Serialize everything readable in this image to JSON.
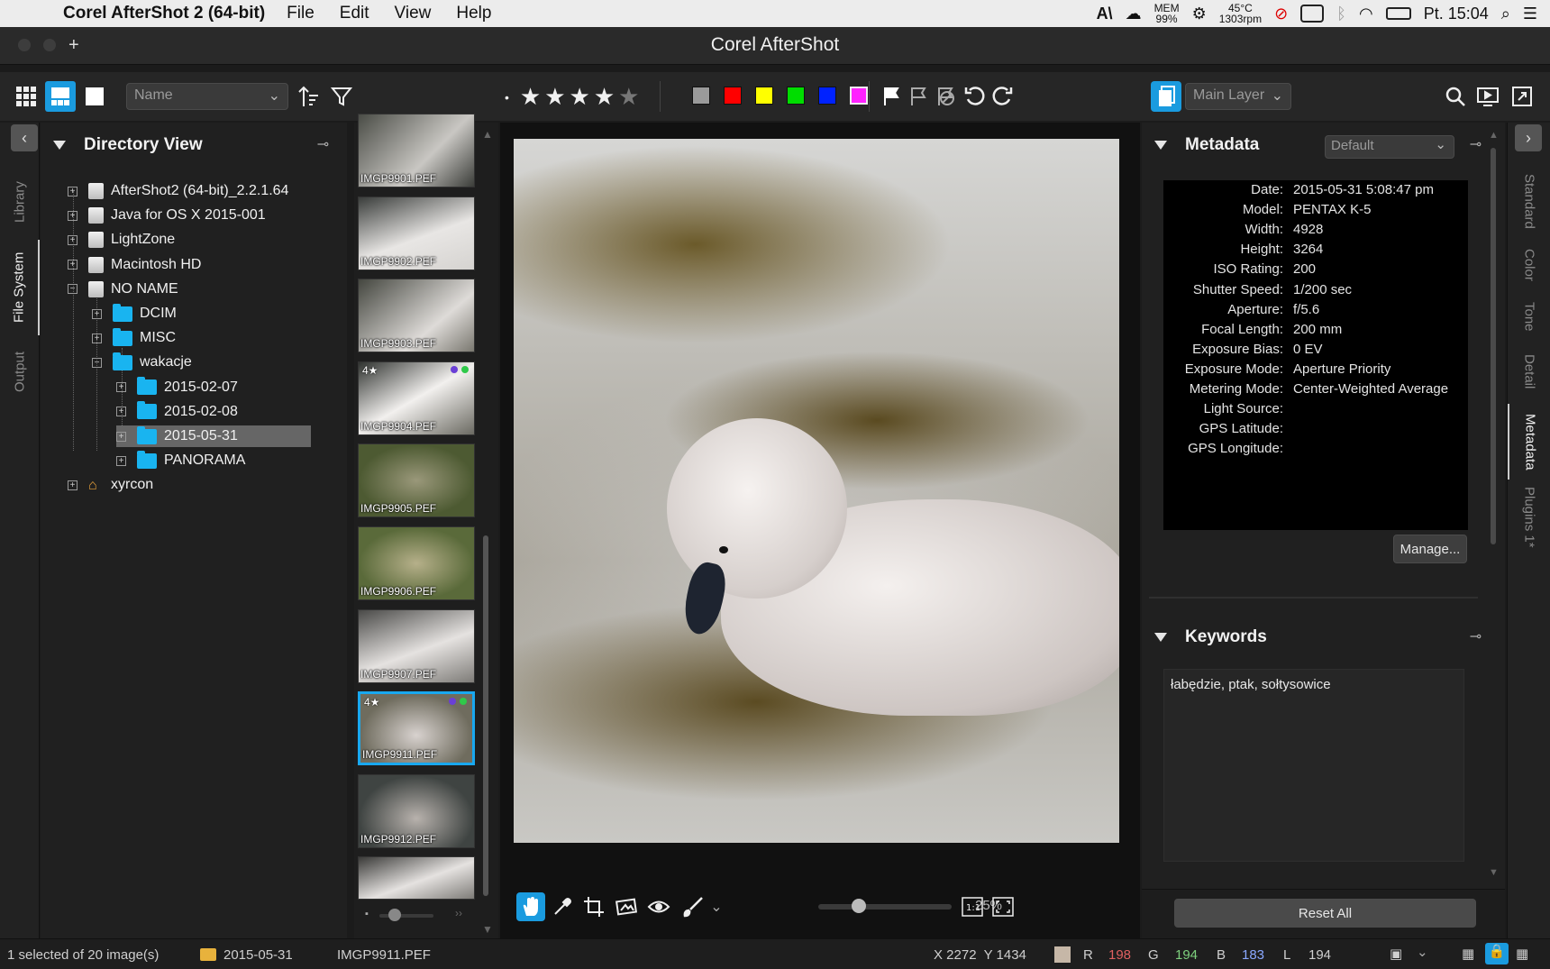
{
  "menubar": {
    "app_name": "Corel AfterShot 2 (64-bit)",
    "menus": [
      "File",
      "Edit",
      "View",
      "Help"
    ],
    "mem_label": "MEM",
    "mem_value": "99%",
    "temp": "45°C",
    "rpm": "1303rpm",
    "clock": "Pt. 15:04"
  },
  "window": {
    "title": "Corel AfterShot"
  },
  "toolbar": {
    "sort_field": "Name",
    "rating_stars": 4,
    "color_labels": [
      "#9a9a9a",
      "#ff0000",
      "#ffff00",
      "#00dd00",
      "#0022ff",
      "#ff22ff"
    ],
    "layer_select": "Main Layer"
  },
  "left_tabs": [
    "Library",
    "File System",
    "Output"
  ],
  "directory": {
    "title": "Directory View",
    "items": [
      {
        "label": "AfterShot2 (64-bit)_2.2.1.64",
        "icon": "drive-icon",
        "expander": "+"
      },
      {
        "label": "Java for OS X 2015-001",
        "icon": "drive-icon",
        "expander": "+"
      },
      {
        "label": "LightZone",
        "icon": "drive-icon",
        "expander": "+"
      },
      {
        "label": "Macintosh HD",
        "icon": "hard-drive-icon",
        "expander": "+"
      },
      {
        "label": "NO NAME",
        "icon": "sd-card-icon",
        "expander": "−"
      },
      {
        "label": "DCIM",
        "icon": "folder-icon",
        "expander": "+"
      },
      {
        "label": "MISC",
        "icon": "folder-icon",
        "expander": "+"
      },
      {
        "label": "wakacje",
        "icon": "folder-icon",
        "expander": "−"
      },
      {
        "label": "2015-02-07",
        "icon": "folder-icon",
        "expander": "+"
      },
      {
        "label": "2015-02-08",
        "icon": "folder-icon",
        "expander": "+"
      },
      {
        "label": "2015-05-31",
        "icon": "folder-icon",
        "expander": "+"
      },
      {
        "label": "PANORAMA",
        "icon": "folder-icon",
        "expander": "+"
      },
      {
        "label": "xyrcon",
        "icon": "home-icon",
        "expander": "+"
      }
    ]
  },
  "filmstrip": {
    "thumbs": [
      {
        "name": "IMGP9901.PEF",
        "rating": ""
      },
      {
        "name": "IMGP9902.PEF",
        "rating": ""
      },
      {
        "name": "IMGP9903.PEF",
        "rating": ""
      },
      {
        "name": "IMGP9904.PEF",
        "rating": "4★"
      },
      {
        "name": "IMGP9905.PEF",
        "rating": ""
      },
      {
        "name": "IMGP9906.PEF",
        "rating": ""
      },
      {
        "name": "IMGP9907.PEF",
        "rating": ""
      },
      {
        "name": "IMGP9911.PEF",
        "rating": "4★"
      },
      {
        "name": "IMGP9912.PEF",
        "rating": ""
      },
      {
        "name": "",
        "rating": ""
      }
    ]
  },
  "preview": {
    "zoom": "25%",
    "zoom_fraction": 0.25
  },
  "metadata": {
    "title": "Metadata",
    "preset": "Default",
    "fields": [
      {
        "key": "Date:",
        "value": "2015-05-31 5:08:47 pm"
      },
      {
        "key": "Model:",
        "value": "PENTAX K-5"
      },
      {
        "key": "Width:",
        "value": "4928"
      },
      {
        "key": "Height:",
        "value": "3264"
      },
      {
        "key": "ISO Rating:",
        "value": "200"
      },
      {
        "key": "Shutter Speed:",
        "value": "1/200 sec"
      },
      {
        "key": "Aperture:",
        "value": "f/5.6"
      },
      {
        "key": "Focal Length:",
        "value": "200 mm"
      },
      {
        "key": "Exposure Bias:",
        "value": "0 EV"
      },
      {
        "key": "Exposure Mode:",
        "value": "Aperture Priority"
      },
      {
        "key": "Metering Mode:",
        "value": "Center-Weighted Average"
      },
      {
        "key": "Light Source:",
        "value": ""
      },
      {
        "key": "GPS Latitude:",
        "value": ""
      },
      {
        "key": "GPS Longitude:",
        "value": ""
      }
    ],
    "manage_label": "Manage..."
  },
  "keywords": {
    "title": "Keywords",
    "text": "łabędzie, ptak, sołtysowice"
  },
  "reset_label": "Reset All",
  "right_tabs": [
    "Standard",
    "Color",
    "Tone",
    "Detail",
    "Metadata",
    "Plugins 1*"
  ],
  "status": {
    "selection": "1 selected of 20 image(s)",
    "folder": "2015-05-31",
    "file": "IMGP9911.PEF",
    "coords": "X 2272  Y 1434",
    "r_label": "R",
    "r": "198",
    "g_label": "G",
    "g": "194",
    "b_label": "B",
    "b": "183",
    "l_label": "L",
    "l": "194"
  }
}
